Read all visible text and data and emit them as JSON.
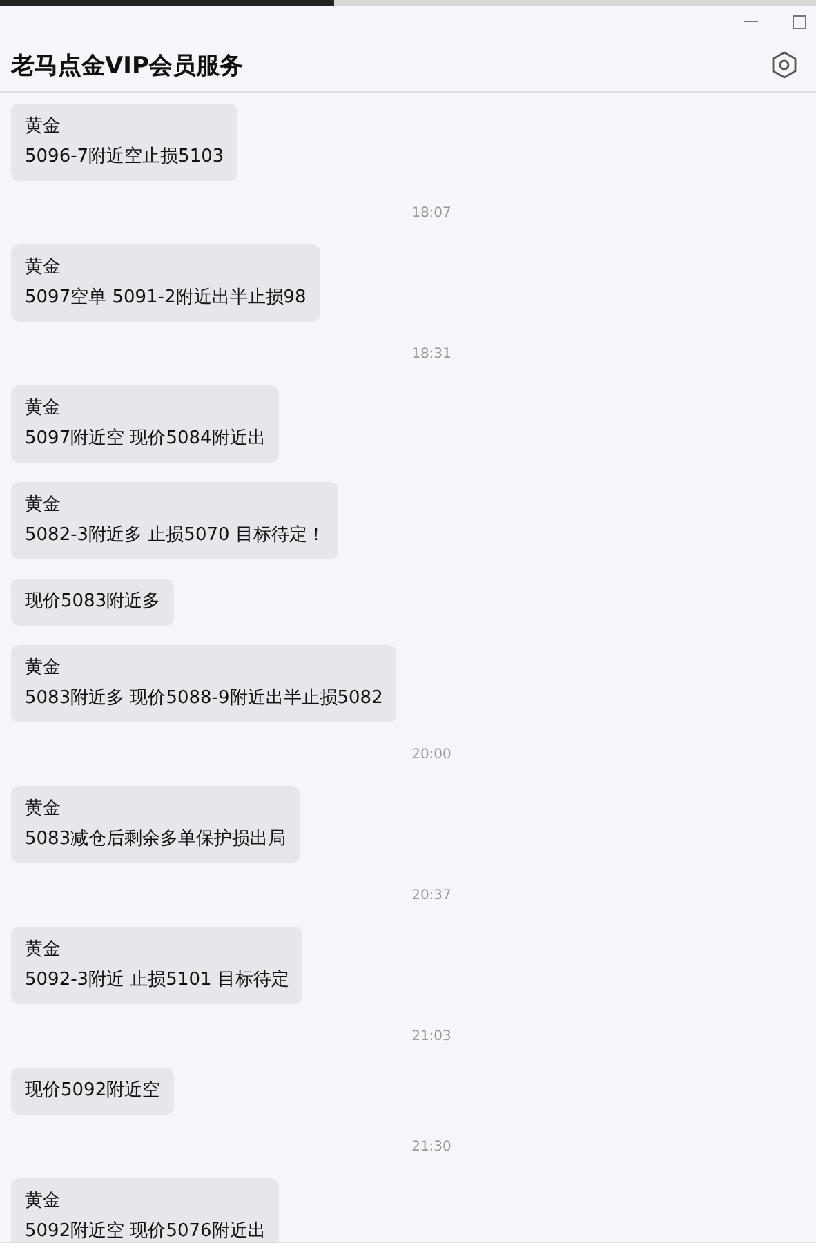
{
  "loading_bar": {
    "level": 0.41
  },
  "window": {
    "title": "老马点金VIP会员服务"
  },
  "messages": [
    {
      "kind": "message",
      "title": "黄金",
      "text": "5096-7附近空止损5103"
    },
    {
      "kind": "time",
      "text": "18:07"
    },
    {
      "kind": "message",
      "title": "黄金",
      "text": "5097空单 5091-2附近出半止损98"
    },
    {
      "kind": "time",
      "text": "18:31"
    },
    {
      "kind": "message",
      "title": "黄金",
      "text": "5097附近空 现价5084附近出"
    },
    {
      "kind": "message",
      "title": "黄金",
      "text": "5082-3附近多 止损5070 目标待定！"
    },
    {
      "kind": "message",
      "text": "现价5083附近多"
    },
    {
      "kind": "message",
      "title": "黄金",
      "text": "5083附近多 现价5088-9附近出半止损5082"
    },
    {
      "kind": "time",
      "text": "20:00"
    },
    {
      "kind": "message",
      "title": "黄金",
      "text": "5083减仓后剩余多单保护损出局"
    },
    {
      "kind": "time",
      "text": "20:37"
    },
    {
      "kind": "message",
      "title": "黄金",
      "text": "5092-3附近 止损5101 目标待定"
    },
    {
      "kind": "time",
      "text": "21:03"
    },
    {
      "kind": "message",
      "text": "现价5092附近空"
    },
    {
      "kind": "time",
      "text": "21:30"
    },
    {
      "kind": "message",
      "title": "黄金",
      "text": "5092附近空 现价5076附近出"
    }
  ]
}
